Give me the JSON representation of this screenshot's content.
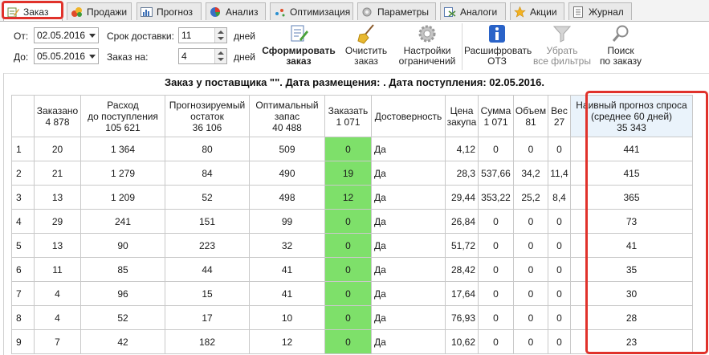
{
  "tabs": [
    {
      "label": "Заказ",
      "icon": "order-pencil-icon",
      "active": true
    },
    {
      "label": "Продажи",
      "icon": "sales-icon"
    },
    {
      "label": "Прогноз",
      "icon": "forecast-chart-icon"
    },
    {
      "label": "Анализ",
      "icon": "pie-chart-icon"
    },
    {
      "label": "Оптимизация",
      "icon": "optimization-icon"
    },
    {
      "label": "Параметры",
      "icon": "gear-icon"
    },
    {
      "label": "Аналоги",
      "icon": "analogs-icon"
    },
    {
      "label": "Акции",
      "icon": "star-icon"
    },
    {
      "label": "Журнал",
      "icon": "journal-icon"
    }
  ],
  "toolbar": {
    "from_label": "От:",
    "from_value": "02.05.2016",
    "to_label": "До:",
    "to_value": "05.05.2016",
    "delivery_label": "Срок доставки:",
    "delivery_value": "11",
    "delivery_unit": "дней",
    "order_for_label": "Заказ на:",
    "order_for_value": "4",
    "order_for_unit": "дней",
    "buttons": [
      {
        "line1": "Сформировать",
        "line2": "заказ",
        "icon": "form-order-icon"
      },
      {
        "line1": "Очистить",
        "line2": "заказ",
        "icon": "broom-icon"
      },
      {
        "line1": "Настройки",
        "line2": "ограничений",
        "icon": "settings-gear-icon"
      },
      {
        "line1": "Расшифровать",
        "line2": "ОТЗ",
        "icon": "info-icon"
      },
      {
        "line1": "Убрать",
        "line2": "все фильтры",
        "icon": "filter-icon"
      },
      {
        "line1": "Поиск",
        "line2": "по заказу",
        "icon": "search-icon"
      }
    ]
  },
  "heading": "Заказ у поставщика \"\". Дата размещения: . Дата поступления: 02.05.2016.",
  "table": {
    "columns": [
      {
        "title": "Заказано",
        "total": "4 878"
      },
      {
        "title": "Расход\nдо поступления",
        "total": "105 621"
      },
      {
        "title": "Прогнозируемый\nостаток",
        "total": "36 106"
      },
      {
        "title": "Оптимальный\nзапас",
        "total": "40 488"
      },
      {
        "title": "Заказать",
        "total": "1 071"
      },
      {
        "title": "Достоверность",
        "total": ""
      },
      {
        "title": "Цена\nзакупа",
        "total": ""
      },
      {
        "title": "Сумма",
        "total": "1 071"
      },
      {
        "title": "Объем",
        "total": "81"
      },
      {
        "title": "Вес",
        "total": "27"
      },
      {
        "title": "Наивный прогноз спроса\n(среднее 60 дней)",
        "total": "35 343"
      }
    ],
    "rows": [
      [
        "1",
        "20",
        "1 364",
        "80",
        "509",
        "0",
        "Да",
        "4,12",
        "0",
        "0",
        "0",
        "441"
      ],
      [
        "2",
        "21",
        "1 279",
        "84",
        "490",
        "19",
        "Да",
        "28,3",
        "537,66",
        "34,2",
        "11,4",
        "415"
      ],
      [
        "3",
        "13",
        "1 209",
        "52",
        "498",
        "12",
        "Да",
        "29,44",
        "353,22",
        "25,2",
        "8,4",
        "365"
      ],
      [
        "4",
        "29",
        "241",
        "151",
        "99",
        "0",
        "Да",
        "26,84",
        "0",
        "0",
        "0",
        "73"
      ],
      [
        "5",
        "13",
        "90",
        "223",
        "32",
        "0",
        "Да",
        "51,72",
        "0",
        "0",
        "0",
        "41"
      ],
      [
        "6",
        "11",
        "85",
        "44",
        "41",
        "0",
        "Да",
        "28,42",
        "0",
        "0",
        "0",
        "35"
      ],
      [
        "7",
        "4",
        "96",
        "15",
        "41",
        "0",
        "Да",
        "17,64",
        "0",
        "0",
        "0",
        "30"
      ],
      [
        "8",
        "4",
        "52",
        "17",
        "10",
        "0",
        "Да",
        "76,93",
        "0",
        "0",
        "0",
        "28"
      ],
      [
        "9",
        "7",
        "42",
        "182",
        "12",
        "0",
        "Да",
        "10,62",
        "0",
        "0",
        "0",
        "23"
      ]
    ]
  },
  "colors": {
    "order_cell": "#7ee06a",
    "highlight": "#e0322b"
  }
}
